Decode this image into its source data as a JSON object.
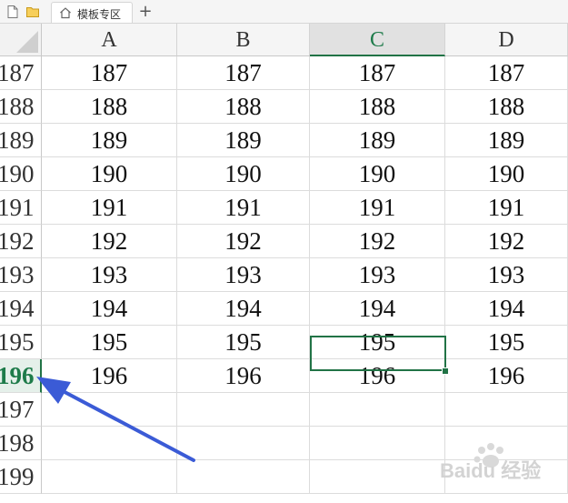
{
  "tabbar": {
    "doc_icon": "new-file-icon",
    "folder_icon": "folder-icon",
    "tab_icon": "home-icon",
    "tab_label": "模板专区",
    "add_label": "+"
  },
  "sheet": {
    "columns": [
      "A",
      "B",
      "C",
      "D"
    ],
    "active_column": "C",
    "active_row": "196",
    "rows": [
      {
        "label": "187",
        "values": [
          "187",
          "187",
          "187",
          "187"
        ]
      },
      {
        "label": "188",
        "values": [
          "188",
          "188",
          "188",
          "188"
        ]
      },
      {
        "label": "189",
        "values": [
          "189",
          "189",
          "189",
          "189"
        ]
      },
      {
        "label": "190",
        "values": [
          "190",
          "190",
          "190",
          "190"
        ]
      },
      {
        "label": "191",
        "values": [
          "191",
          "191",
          "191",
          "191"
        ]
      },
      {
        "label": "192",
        "values": [
          "192",
          "192",
          "192",
          "192"
        ]
      },
      {
        "label": "193",
        "values": [
          "193",
          "193",
          "193",
          "193"
        ]
      },
      {
        "label": "194",
        "values": [
          "194",
          "194",
          "194",
          "194"
        ]
      },
      {
        "label": "195",
        "values": [
          "195",
          "195",
          "195",
          "195"
        ]
      },
      {
        "label": "196",
        "values": [
          "196",
          "196",
          "196",
          "196"
        ]
      },
      {
        "label": "197",
        "values": [
          "",
          "",
          "",
          ""
        ]
      },
      {
        "label": "198",
        "values": [
          "",
          "",
          "",
          ""
        ]
      },
      {
        "label": "199",
        "values": [
          "",
          "",
          "",
          ""
        ]
      }
    ]
  },
  "annotation": {
    "arrow_color": "#3b5bd6",
    "target_row": "196"
  },
  "watermark": {
    "text": "Baidu 经验",
    "icon": "baidu-paw-icon"
  },
  "colors": {
    "accent": "#217346",
    "active_header_bg": "#e1e1e1"
  }
}
